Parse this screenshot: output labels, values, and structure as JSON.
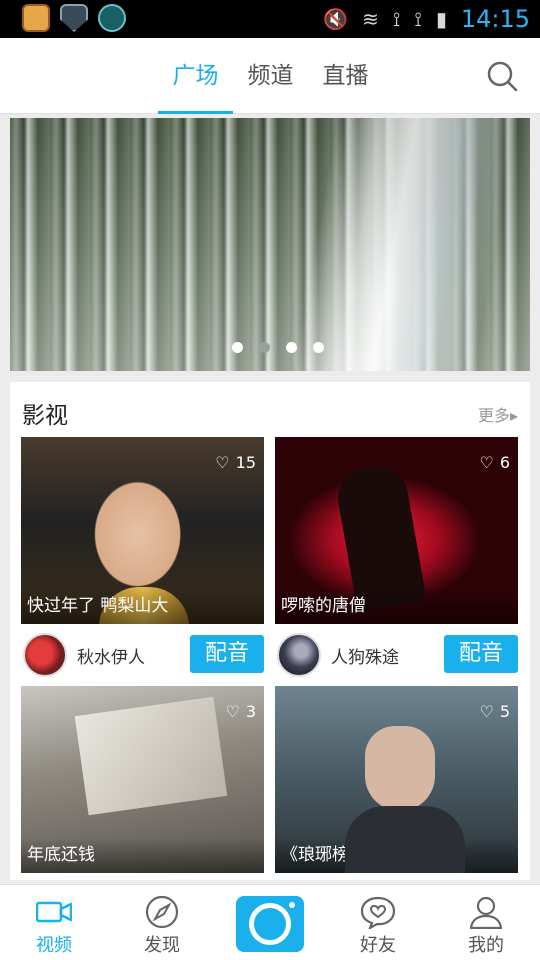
{
  "status_bar": {
    "time": "14:15"
  },
  "topnav": {
    "tabs": [
      {
        "label": "广场",
        "active": true
      },
      {
        "label": "频道",
        "active": false
      },
      {
        "label": "直播",
        "active": false
      }
    ]
  },
  "banner": {
    "page_count": 4,
    "active_index": 0
  },
  "section": {
    "title": "影视",
    "more": "更多▸",
    "cards": [
      {
        "caption": "快过年了 鸭梨山大",
        "likes": "15",
        "user": "秋水伊人",
        "button": "配音"
      },
      {
        "caption": "啰嗦的唐僧",
        "likes": "6",
        "user": "人狗殊途",
        "button": "配音"
      },
      {
        "caption": "年底还钱",
        "likes": "3"
      },
      {
        "caption": "《琅琊榜》结局",
        "likes": "5"
      }
    ]
  },
  "bottomnav": {
    "items": [
      {
        "label": "视频",
        "icon": "video-icon",
        "active": true
      },
      {
        "label": "发现",
        "icon": "compass-icon",
        "active": false
      },
      {
        "label": "好友",
        "icon": "friends-chat-icon",
        "active": false
      },
      {
        "label": "我的",
        "icon": "person-icon",
        "active": false
      }
    ]
  },
  "colors": {
    "accent": "#1ab0ec"
  }
}
